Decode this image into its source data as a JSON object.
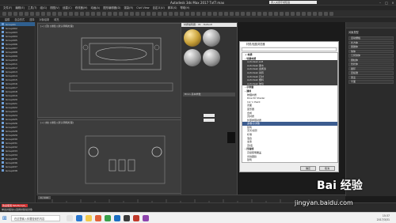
{
  "window": {
    "title": "Autodesk 3ds Max 2017   Txf7.max",
    "search_placeholder": "键入关键字或短语"
  },
  "menu": [
    "文件(F)",
    "编辑(E)",
    "工具(T)",
    "组(G)",
    "视图(V)",
    "创建(C)",
    "修改器(M)",
    "动画(A)",
    "图形编辑器(D)",
    "渲染(R)",
    "Civil View",
    "自定义(U)",
    "脚本(S)",
    "帮助(H)"
  ],
  "ribbon": [
    "建模",
    "自由形式",
    "选择",
    "对象绘制",
    "填充"
  ],
  "scene_explorer": {
    "rows": [
      {
        "label": "Group01",
        "selected": true
      },
      {
        "label": "Group002",
        "selected": false
      },
      {
        "label": "Group003",
        "selected": false
      },
      {
        "label": "Group004",
        "selected": false
      },
      {
        "label": "Group005",
        "selected": false
      },
      {
        "label": "Group006",
        "selected": false
      },
      {
        "label": "Group007",
        "selected": false
      },
      {
        "label": "Group008",
        "selected": false
      },
      {
        "label": "Group009",
        "selected": false
      },
      {
        "label": "Group010",
        "selected": false
      },
      {
        "label": "Group011",
        "selected": false
      },
      {
        "label": "Group012",
        "selected": false
      },
      {
        "label": "Group013",
        "selected": false
      },
      {
        "label": "Group014",
        "selected": false
      },
      {
        "label": "Group015",
        "selected": false
      },
      {
        "label": "Group016",
        "selected": false
      },
      {
        "label": "Group017",
        "selected": false
      },
      {
        "label": "Group018",
        "selected": false
      },
      {
        "label": "Group019",
        "selected": false
      },
      {
        "label": "Group020",
        "selected": false
      },
      {
        "label": "Group021",
        "selected": false
      },
      {
        "label": "Group022",
        "selected": false
      },
      {
        "label": "Group023",
        "selected": false
      },
      {
        "label": "Group024",
        "selected": false
      },
      {
        "label": "Group025",
        "selected": false
      },
      {
        "label": "Group026",
        "selected": false
      },
      {
        "label": "Group027",
        "selected": false
      },
      {
        "label": "Group028",
        "selected": false
      },
      {
        "label": "Group029",
        "selected": false
      },
      {
        "label": "Group030",
        "selected": false
      },
      {
        "label": "Group031",
        "selected": false
      },
      {
        "label": "Group032",
        "selected": false
      },
      {
        "label": "Group033",
        "selected": false
      },
      {
        "label": "Group034",
        "selected": false
      },
      {
        "label": "Group035",
        "selected": false
      },
      {
        "label": "Group036",
        "selected": false
      },
      {
        "label": "Group037",
        "selected": false
      },
      {
        "label": "Group038",
        "selected": false
      }
    ]
  },
  "viewports": {
    "top_label": "[+] [顶] [线框] [默认明暗处理]",
    "front_label": "[+] [前] [线框] [默认明暗处理]"
  },
  "slate": {
    "title": "材质编辑器 - 01 - Default",
    "params_label": "Blinn 基本参数"
  },
  "material_browser": {
    "title": "材质/贴图浏览器",
    "group_header": "+ 材质",
    "groups": [
      {
        "label": "- 场景材质",
        "rows": [
          "autodesk.ao8",
          "Autodesk 硬木",
          "Autodesk 金属漆",
          "Autodesk 瓷砖",
          "Autodesk 石材",
          "Autodesk 塑料",
          "Autodesk 玻璃"
        ]
      },
      {
        "label": "- 示例窗",
        "rows": []
      },
      {
        "label": "- 通用",
        "rows": [
          "物理材质",
          "DirectX Shader",
          "Ink 'n Paint",
          "双面",
          "变形器",
          "合成",
          "壳材质",
          "外部参照材质",
          "多维/子对象",
          "建筑",
          "无光/投影",
          "标准",
          "混合",
          "虫漆",
          "顶/底"
        ]
      },
      {
        "label": "- 扫描线",
        "rows": [
          "高级照明覆盖",
          "光线跟踪",
          "建筑"
        ]
      }
    ],
    "selected_row": "多维/子对象",
    "ok_label": "确定",
    "cancel_label": "取消"
  },
  "command_panel": {
    "title": "对象类型",
    "rows": [
      "自动栅格",
      "长方体",
      "圆锥体",
      "球体",
      "几何球体",
      "圆柱体",
      "管状体",
      "圆环",
      "四棱锥",
      "茶壶",
      "平面"
    ]
  },
  "timeline": {
    "frame_display": "0 / 100"
  },
  "statusbar": {
    "status": "欢迎使用 MAXScript。",
    "prompt": "单击并拖动以选择并移动对象"
  },
  "taskbar": {
    "search_placeholder": "在这里输入你要搜索的内容",
    "time": "15:37",
    "date": "2017/3/31"
  },
  "watermark": {
    "brand": "Bai 经验",
    "url": "jingyan.baidu.com"
  }
}
